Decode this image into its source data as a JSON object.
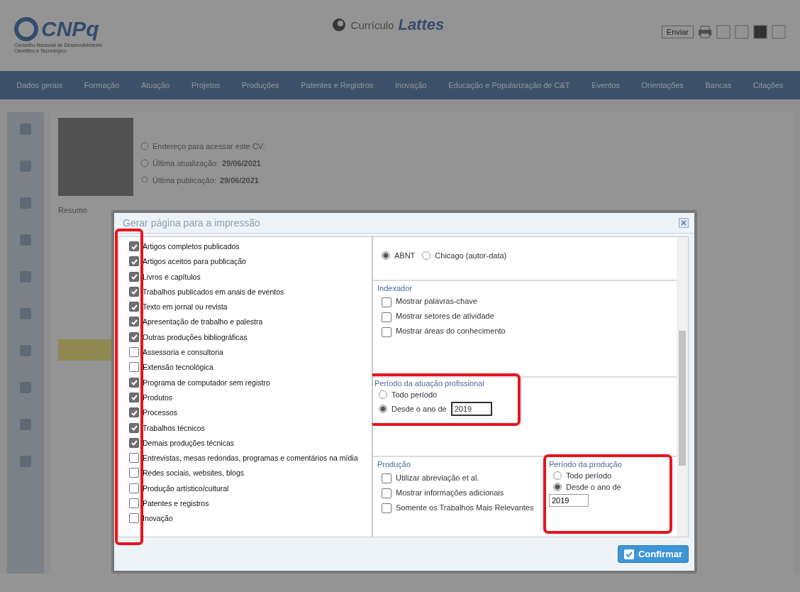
{
  "header": {
    "logo_text": "CNPq",
    "logo_subtitle": "Conselho Nacional de Desenvolvimento Científico e Tecnológico",
    "app_title_prefix": "Currículo",
    "app_title": "Lattes",
    "send_button": "Enviar"
  },
  "nav": [
    "Dados gerais",
    "Formação",
    "Atuação",
    "Projetos",
    "Produções",
    "Patentes e Registros",
    "Inovação",
    "Educação e Popularização de C&T",
    "Eventos",
    "Orientações",
    "Bancas",
    "Citações"
  ],
  "profile": {
    "address_label": "Endereço para acessar este CV:",
    "updated_label": "Última atualização:",
    "updated_date": "29/06/2021",
    "published_label": "Última publicação:",
    "published_date": "29/06/2021",
    "summary_label": "Resumo"
  },
  "dialog": {
    "title": "Gerar página para a impressão",
    "items_highlighted": true,
    "items": [
      {
        "label": "Artigos completos publicados",
        "checked": true
      },
      {
        "label": "Artigos aceitos para publicação",
        "checked": true
      },
      {
        "label": "Livros e capítulos",
        "checked": true
      },
      {
        "label": "Trabalhos publicados em anais de eventos",
        "checked": true
      },
      {
        "label": "Texto em jornal ou revista",
        "checked": true
      },
      {
        "label": "Apresentação de trabalho e palestra",
        "checked": true
      },
      {
        "label": "Outras produções bibliográficas",
        "checked": true
      },
      {
        "label": "Assessoria e consultoria",
        "checked": false
      },
      {
        "label": "Extensão tecnológica",
        "checked": false
      },
      {
        "label": "Programa de computador sem registro",
        "checked": true
      },
      {
        "label": "Produtos",
        "checked": true
      },
      {
        "label": "Processos",
        "checked": true
      },
      {
        "label": "Trabalhos técnicos",
        "checked": true
      },
      {
        "label": "Demais produções técnicas",
        "checked": true
      },
      {
        "label": "Entrevistas, mesas redondas, programas e comentários na mídia",
        "checked": false
      },
      {
        "label": "Redes sociais, websites, blogs",
        "checked": false
      },
      {
        "label": "Produção artístico/cultural",
        "checked": false
      },
      {
        "label": "Patentes e registros",
        "checked": false
      },
      {
        "label": "Inovação",
        "checked": false
      }
    ],
    "style_options": [
      {
        "label": "ABNT",
        "selected": true
      },
      {
        "label": "Chicago (autor-data)",
        "selected": false
      }
    ],
    "indexer": {
      "title": "Indexador",
      "options": [
        {
          "label": "Mostrar palavras-chave",
          "checked": false
        },
        {
          "label": "Mostrar setores de atividade",
          "checked": false
        },
        {
          "label": "Mostrar áreas do conhecimento",
          "checked": false
        }
      ]
    },
    "period_work": {
      "title": "Período da atuação profissional",
      "highlighted": true,
      "options": [
        {
          "label": "Todo período",
          "selected": false
        },
        {
          "label": "Desde o ano de",
          "selected": true
        }
      ],
      "year": "2019"
    },
    "production": {
      "title": "Produção",
      "options": [
        {
          "label": "Utilizar abreviação et al.",
          "checked": false
        },
        {
          "label": "Mostrar informações adicionais",
          "checked": false
        },
        {
          "label": "Somente os Trabalhos Mais Relevantes",
          "checked": false
        }
      ]
    },
    "period_production": {
      "title": "Período da produção",
      "highlighted": true,
      "options": [
        {
          "label": "Todo período",
          "selected": false
        },
        {
          "label": "Desde o ano de",
          "selected": true
        }
      ],
      "year": "2019"
    },
    "confirm_button": "Confirmar"
  }
}
